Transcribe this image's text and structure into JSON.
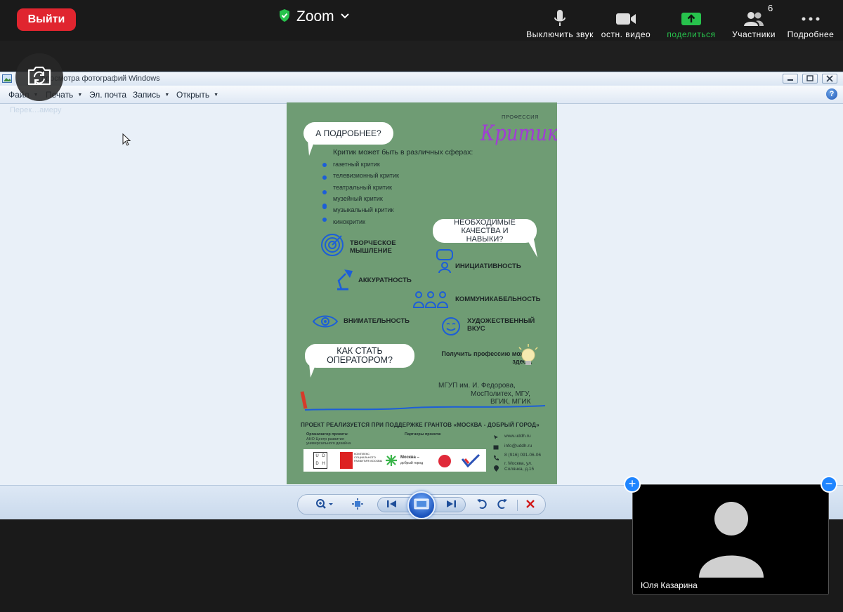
{
  "zoom": {
    "leave_label": "Выйти",
    "app_title": "Zoom",
    "toolbar": {
      "mute_label": "Выключить звук",
      "video_label": "остн. видео",
      "share_label": "поделиться",
      "participants_label": "Участники",
      "participants_count": "6",
      "more_label": "Подробнее"
    },
    "camera_tip": "Перек…амеру",
    "self_view_name": "Юля Казарина",
    "colors": {
      "leave": "#e0252f",
      "share": "#27c24c",
      "accent": "#1f85ff"
    }
  },
  "viewer": {
    "title": "…просмотра фотографий Windows",
    "menu": [
      {
        "label": "Файл",
        "arrow": true
      },
      {
        "label": "Печать",
        "arrow": true
      },
      {
        "label": "Эл. почта",
        "arrow": false
      },
      {
        "label": "Запись",
        "arrow": true
      },
      {
        "label": "Открыть",
        "arrow": true
      }
    ],
    "help": "?"
  },
  "poster": {
    "profession_label": "ПРОФЕССИЯ",
    "profession_name": "Критик",
    "bubble_more": "А ПОДРОБНЕЕ?",
    "spheres_heading": "Критик может быть в различных сферах:",
    "spheres": [
      "газетный критик",
      "телевизионный критик",
      "театральный критик",
      "музейный критик",
      "музыкальный критик",
      "кинокритик"
    ],
    "bubble_qualities": "НЕОБХОДИМЫЕ КАЧЕСТВА И НАВЫКИ?",
    "skills": {
      "creative": "ТВОРЧЕСКОЕ МЫШЛЕНИЕ",
      "initiative": "ИНИЦИАТИВНОСТЬ",
      "accuracy": "АККУРАТНОСТЬ",
      "communication": "КОММУНИКАБЕЛЬНОСТЬ",
      "attention": "ВНИМАТЕЛЬНОСТЬ",
      "taste": "ХУДОЖЕСТВЕННЫЙ ВКУС"
    },
    "bubble_how": "КАК СТАТЬ ОПЕРАТОРОМ?",
    "get_profession": "Получить профессию можно здесь:",
    "universities": [
      "МГУП им. И. Федорова,",
      "МосПолитех, МГУ,",
      "ВГИК, МГИК"
    ],
    "grant_line": "ПРОЕКТ РЕАЛИЗУЕТСЯ ПРИ ПОДДЕРЖКЕ ГРАНТОВ «МОСКВА - ДОБРЫЙ ГОРОД»",
    "organizer_title": "Организатор проекта:",
    "organizer_name": "АНО Центр развития универсального дизайна",
    "partners_title": "Партнеры проекта:",
    "contacts": [
      "www.uddh.ru",
      "info@uddh.ru",
      "8 (916) 091-06-06",
      "г. Москва, ул. Солянка, д.15"
    ],
    "logo_uddh": [
      "U",
      "D",
      "D",
      "H"
    ],
    "logo_complex": "КОМПЛЕКС СОЦИАЛЬНОГО РАЗВИТИЯ МОСКВЫ",
    "logo_city_title": "Москва –",
    "logo_city_sub": "добрый город",
    "colors": {
      "background": "#6f9c74",
      "title": "#a23bd6",
      "icons": "#1c5ed8"
    }
  }
}
